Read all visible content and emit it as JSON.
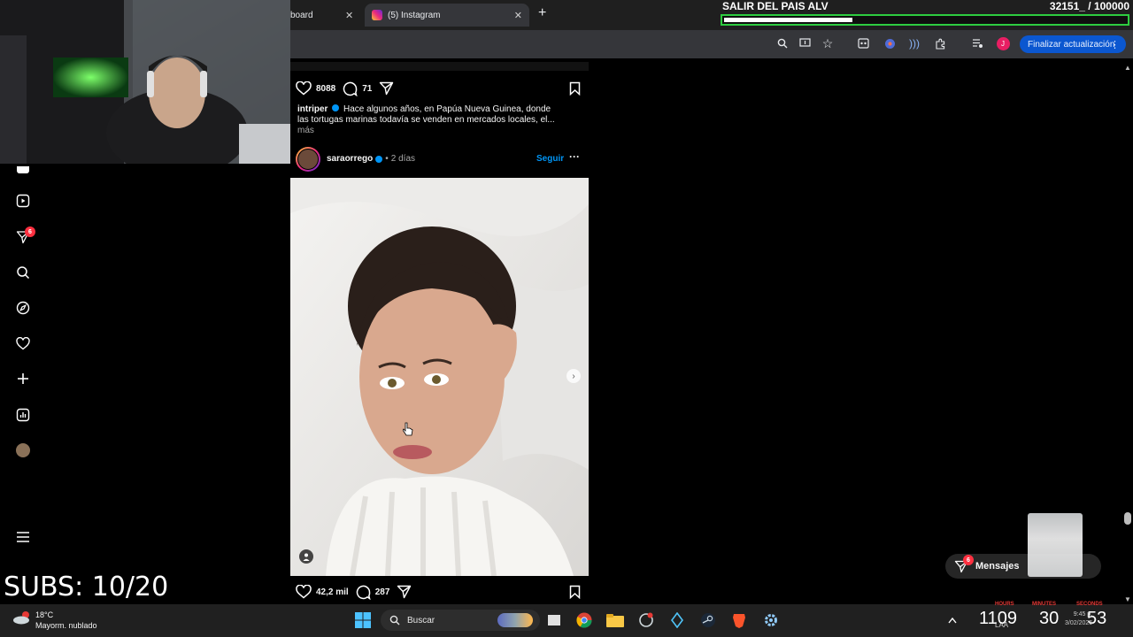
{
  "browser": {
    "tabs": [
      {
        "label": "board"
      },
      {
        "label": "(5) Instagram"
      }
    ],
    "update_button": "Finalizar actualización",
    "profile_initial": "J"
  },
  "goal": {
    "title": "SALIR DEL PAIS ALV",
    "count": "32151_ / 100000",
    "progress_percent": 32
  },
  "sidebar": {
    "notifications_badge": "6"
  },
  "feed": {
    "previous_post": {
      "likes": "8088",
      "comments": "71",
      "caption_user": "intriper",
      "caption_text": "Hace algunos años, en Papúa Nueva Guinea, donde las tortugas marinas todavía se venden en mercados locales, el...",
      "more": "más"
    },
    "post": {
      "username": "saraorrego",
      "separator": "•",
      "time": "2 días",
      "follow": "Seguir",
      "likes": "42,2 mil",
      "comments": "287"
    }
  },
  "messages": {
    "label": "Mensajes",
    "badge": "6"
  },
  "overlay": {
    "subs": "SUBS: 10/20"
  },
  "taskbar": {
    "weather_temp": "18°C",
    "weather_desc": "Mayorm. nublado",
    "search_placeholder": "Buscar",
    "lang": "LAA",
    "time_small": "9:45 p.",
    "date_small": "3/02/2026",
    "timer": {
      "hours": "1109",
      "minutes": "30",
      "seconds": "53",
      "hours_label": "HOURS",
      "minutes_label": "MINUTES",
      "seconds_label": "SECONDS"
    }
  },
  "colors": {
    "accent_blue": "#0095f6",
    "goal_green": "#2ecc40",
    "badge_red": "#ff3040"
  }
}
